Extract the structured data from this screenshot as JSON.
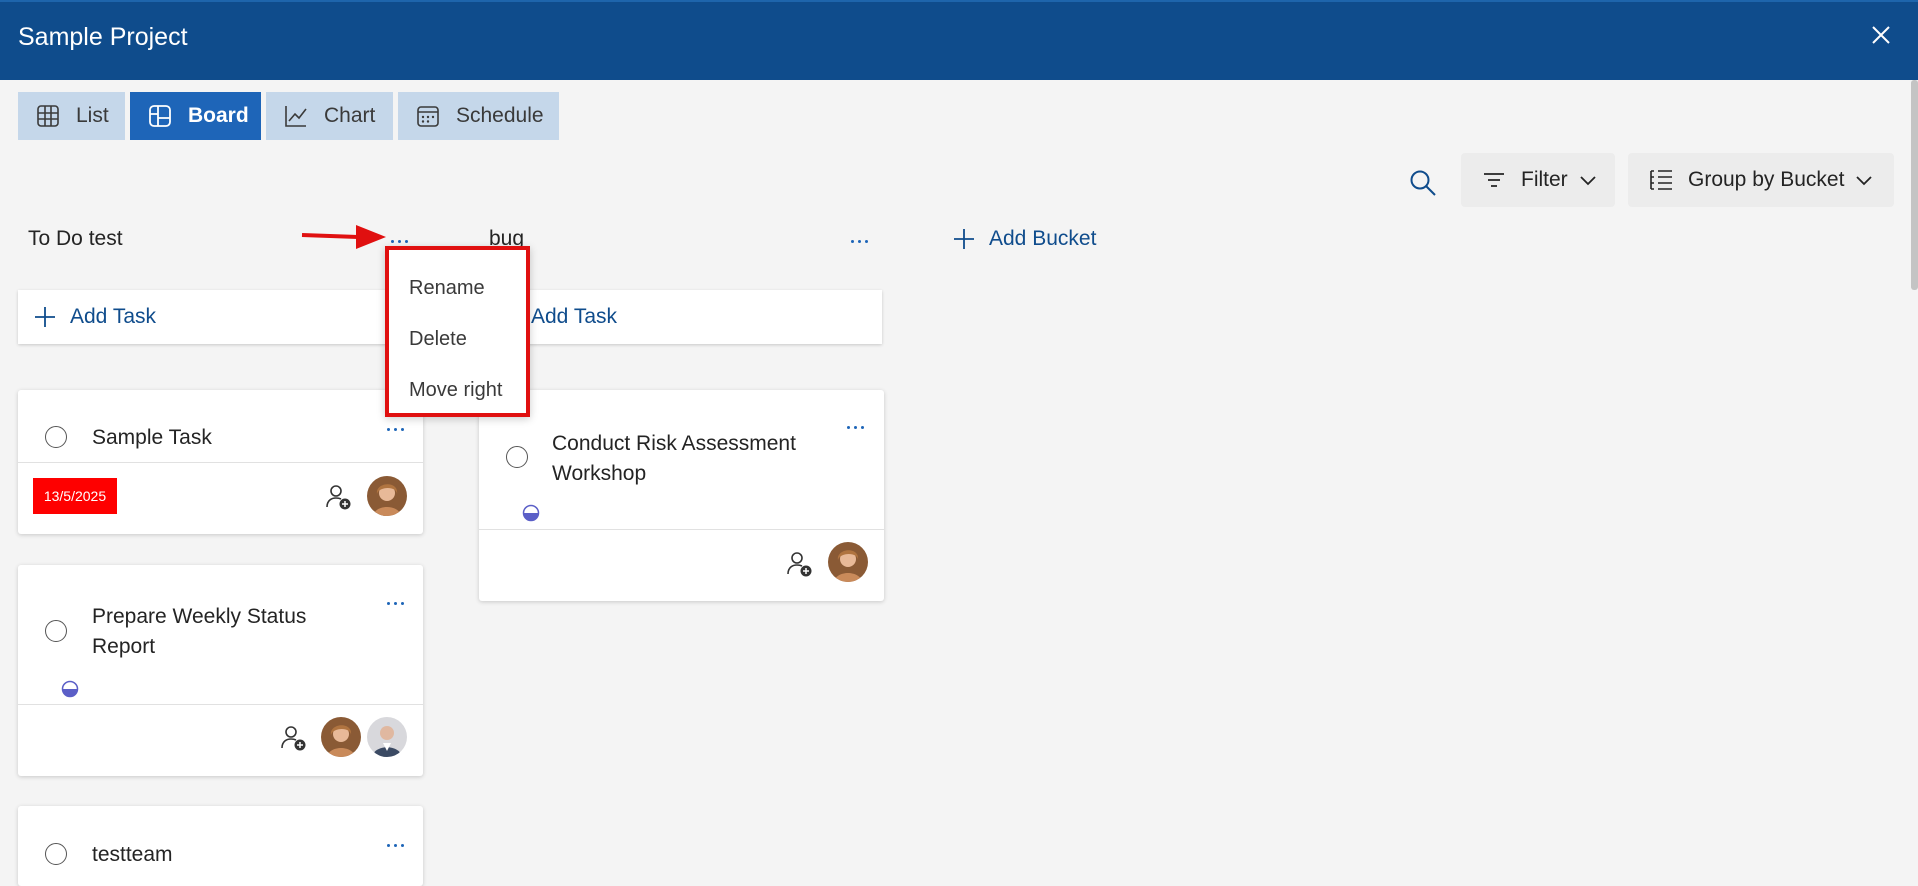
{
  "window": {
    "title": "Sample Project"
  },
  "tabs": [
    {
      "label": "List",
      "icon": "grid-icon"
    },
    {
      "label": "Board",
      "icon": "board-icon",
      "active": true
    },
    {
      "label": "Chart",
      "icon": "chart-icon"
    },
    {
      "label": "Schedule",
      "icon": "calendar-icon"
    }
  ],
  "toolbar": {
    "filter_label": "Filter",
    "group_label": "Group by Bucket"
  },
  "buckets": [
    {
      "name": "To Do test",
      "add_task_label": "Add Task",
      "tasks": [
        {
          "title": "Sample Task",
          "due": "13/5/2025"
        },
        {
          "title": "Prepare Weekly Status Report",
          "progress": "in-progress"
        },
        {
          "title": "testteam"
        }
      ]
    },
    {
      "name": "bug",
      "add_task_label": "Add Task",
      "tasks": [
        {
          "title": "Conduct Risk Assessment Workshop",
          "progress": "in-progress"
        }
      ]
    }
  ],
  "add_bucket_label": "Add Bucket",
  "context_menu": {
    "items": [
      "Rename",
      "Delete",
      "Move right"
    ]
  },
  "colors": {
    "header": "#0f4c8c",
    "accent": "#1e65b8",
    "due_badge": "#fe0000",
    "highlight": "#e01010"
  }
}
